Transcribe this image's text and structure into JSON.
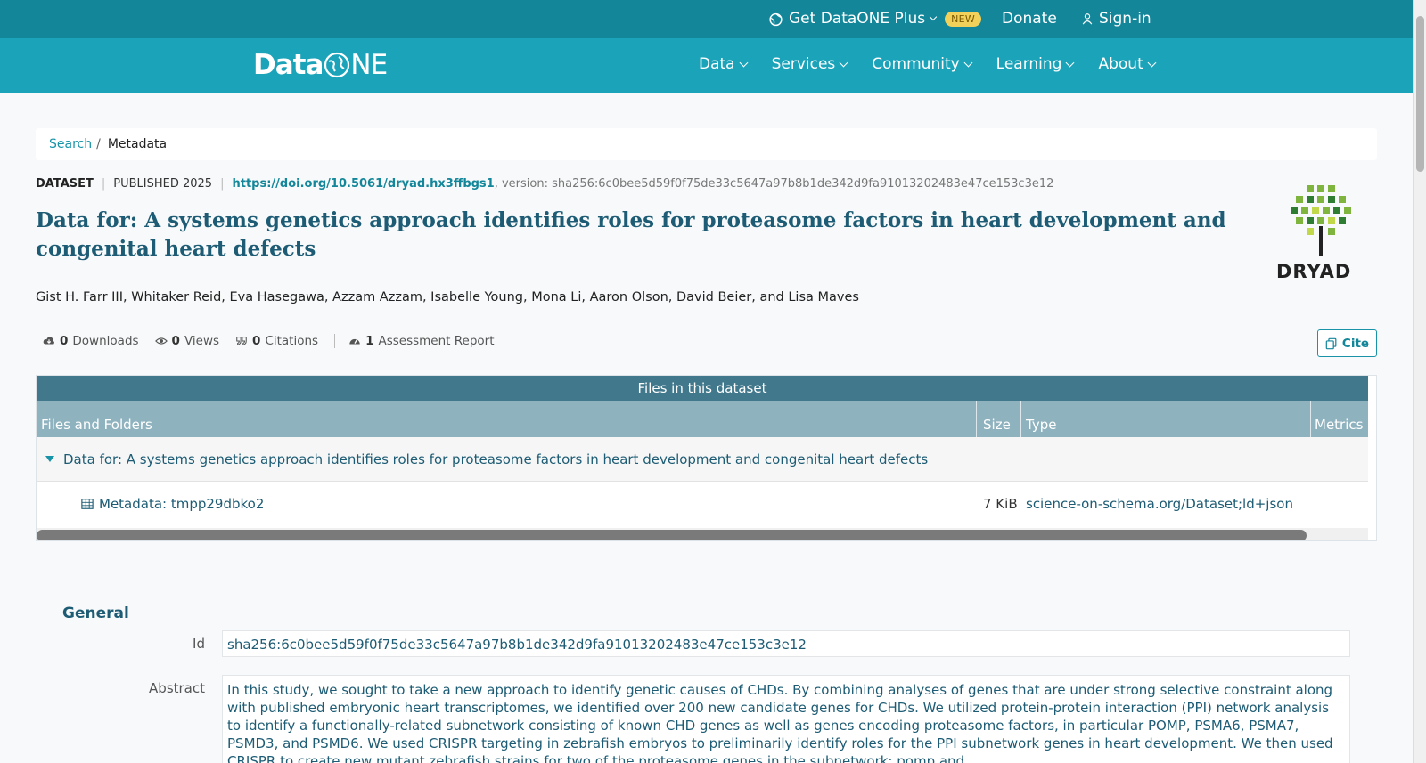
{
  "topbar": {
    "plus_label": "Get DataONE Plus",
    "new_badge": "NEW",
    "donate_label": "Donate",
    "signin_label": "Sign-in"
  },
  "nav": {
    "logo_text_a": "Data",
    "logo_text_b": "NE",
    "items": [
      {
        "label": "Data"
      },
      {
        "label": "Services"
      },
      {
        "label": "Community"
      },
      {
        "label": "Learning"
      },
      {
        "label": "About"
      }
    ]
  },
  "breadcrumb": {
    "search": "Search",
    "separator": "/",
    "current": "Metadata"
  },
  "dataset": {
    "type_label": "DATASET",
    "published": "PUBLISHED 2025",
    "doi": "https://doi.org/10.5061/dryad.hx3ffbgs1",
    "version_text": ", version: sha256:6c0bee5d59f0f75de33c5647a97b8b1de342d9fa91013202483e47ce153c3e12",
    "title": "Data for: A systems genetics approach identifies roles for proteasome factors in heart development and congenital heart defects",
    "authors": "Gist H. Farr III, Whitaker Reid, Eva Hasegawa, Azzam Azzam, Isabelle Young, Mona Li, Aaron Olson, David Beier, and Lisa Maves",
    "repository_logo": "DRYAD"
  },
  "stats": {
    "downloads_num": "0",
    "downloads_label": "Downloads",
    "views_num": "0",
    "views_label": "Views",
    "citations_num": "0",
    "citations_label": "Citations",
    "assessment_num": "1",
    "assessment_label": "Assessment Report",
    "cite_label": "Cite"
  },
  "files": {
    "caption": "Files in this dataset",
    "headers": [
      "Files and Folders",
      "Size",
      "Type",
      "Metrics"
    ],
    "folder": "Data for: A systems genetics approach identifies roles for proteasome factors in heart development and congenital heart defects",
    "rows": [
      {
        "name": "Metadata: tmpp29dbko2",
        "size": "7 KiB",
        "type": "science-on-schema.org/Dataset;ld+json"
      }
    ]
  },
  "general": {
    "heading": "General",
    "id_label": "Id",
    "id_value": "sha256:6c0bee5d59f0f75de33c5647a97b8b1de342d9fa91013202483e47ce153c3e12",
    "abstract_label": "Abstract",
    "abstract_value": "In this study, we sought to take a new approach to identify genetic causes of CHDs. By combining analyses of genes that are under strong selective constraint along with published embryonic heart transcriptomes, we identified over 200 new candidate genes for CHDs. We utilized protein-protein interaction (PPI) network analysis to identify a functionally-related subnetwork consisting of known CHD genes as well as genes encoding proteasome factors, in particular POMP, PSMA6, PSMA7, PSMD3, and PSMD6. We used CRISPR targeting in zebrafish embryos to preliminarily identify roles for the PPI subnetwork genes in heart development. We then used CRISPR to create new mutant zebrafish strains for two of the proteasome genes in the subnetwork: pomp and"
  },
  "colors": {
    "topbar": "#13869a",
    "nav": "#1ba3ba",
    "title": "#1d5c74",
    "table_caption": "#41788c",
    "table_header": "#8fb2bf"
  }
}
